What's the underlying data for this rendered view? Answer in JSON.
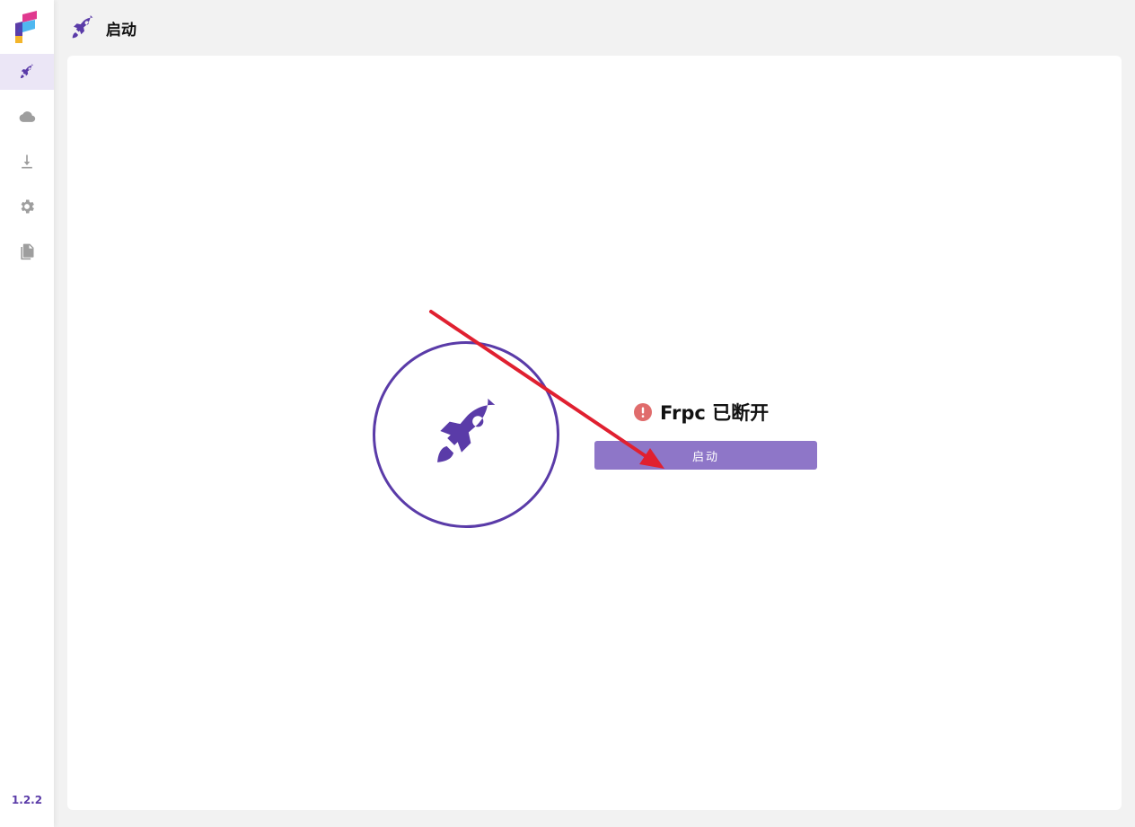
{
  "app": {
    "version": "1.2.2"
  },
  "sidebar": {
    "items": [
      {
        "name": "rocket-icon",
        "active": true
      },
      {
        "name": "cloud-icon",
        "active": false
      },
      {
        "name": "download-icon",
        "active": false
      },
      {
        "name": "gear-icon",
        "active": false
      },
      {
        "name": "document-icon",
        "active": false
      }
    ]
  },
  "header": {
    "title": "启动"
  },
  "main": {
    "status_text": "Frpc 已断开",
    "status_icon": "alert-circle-icon",
    "start_button_label": "启动"
  },
  "colors": {
    "accent": "#5a3ba8",
    "button": "#8e76c8",
    "status_error": "#e06c6c",
    "annotation_arrow": "#e02030"
  }
}
